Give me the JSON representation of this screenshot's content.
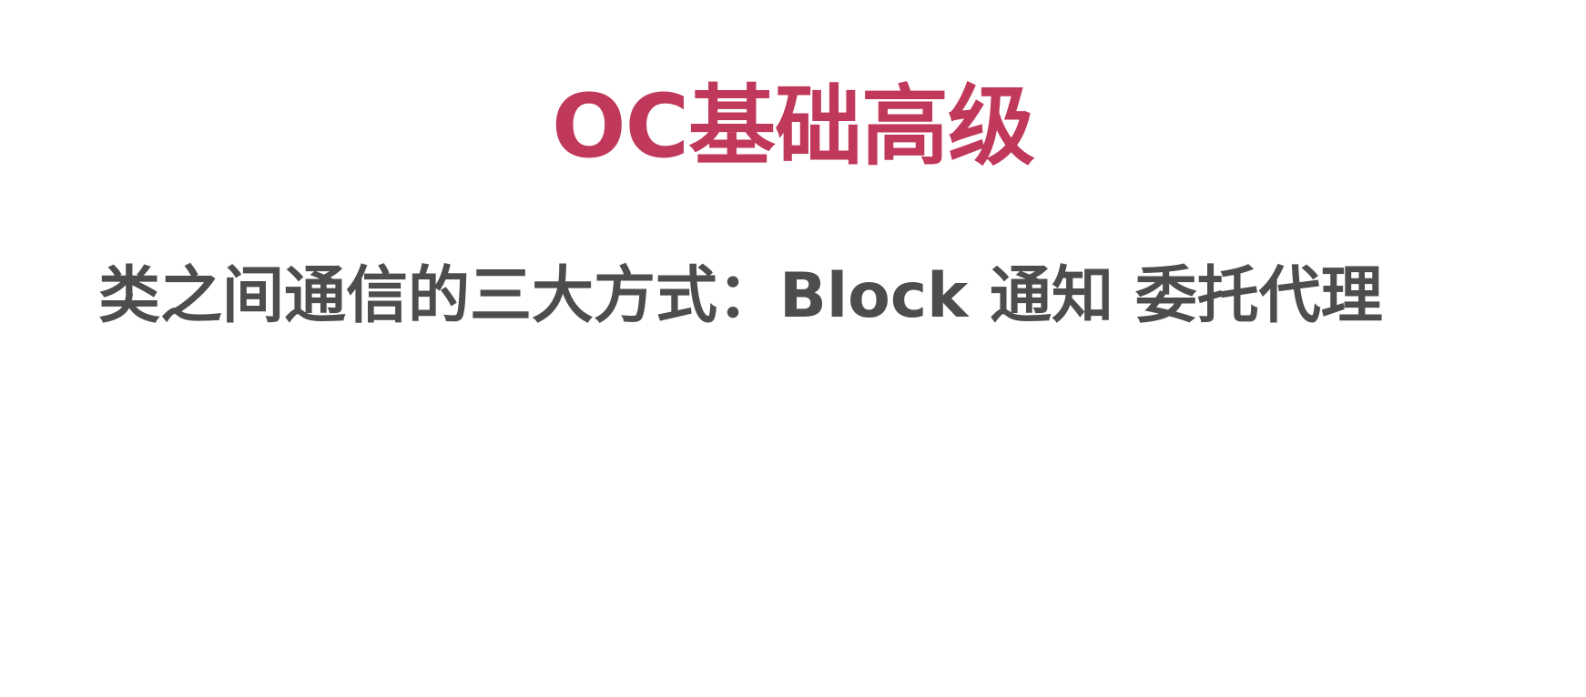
{
  "slide": {
    "title": "OC基础高级",
    "body_line": "类之间通信的三大方式：Block 通知 委托代理",
    "colors": {
      "title": "#c0395b",
      "body": "#4d4d4d",
      "background": "#ffffff"
    }
  }
}
